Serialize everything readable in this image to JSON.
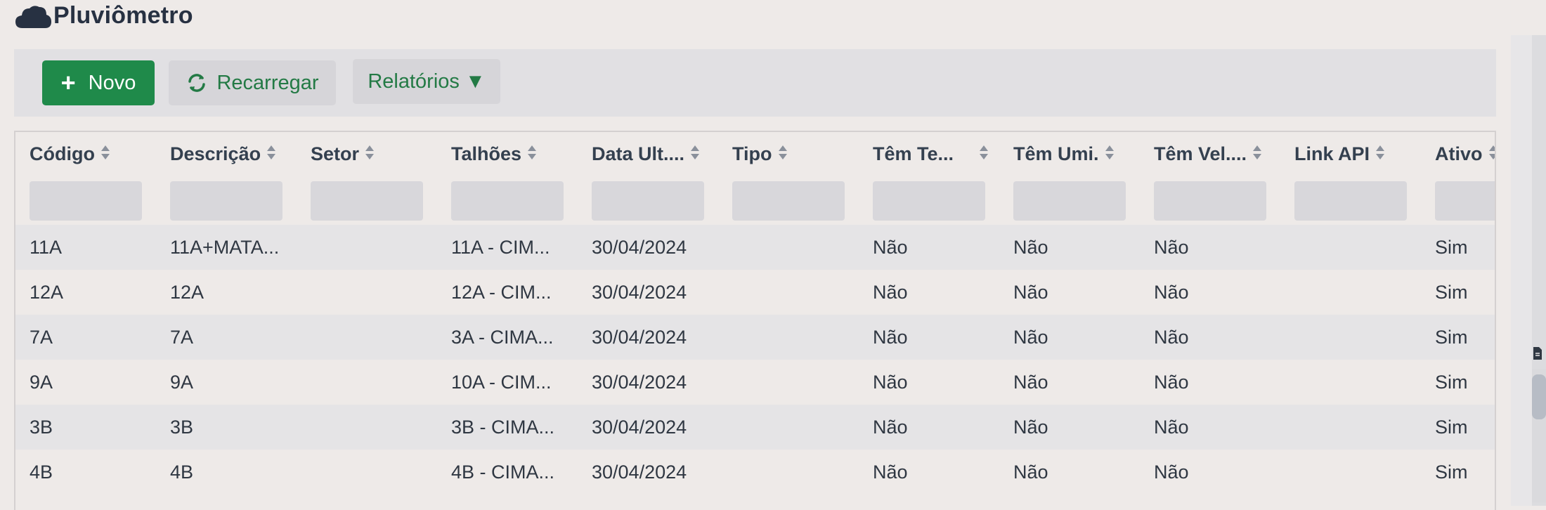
{
  "page": {
    "title": "Pluviômetro",
    "title_icon": "cloud-icon"
  },
  "toolbar": {
    "new_label": "Novo",
    "reload_label": "Recarregar",
    "reports_label": "Relatórios ▼"
  },
  "colors": {
    "primary_green": "#1f8a4a",
    "text_green": "#237a45",
    "title": "#273142",
    "row_alt": "#e5e4e6",
    "background": "#eeeae8"
  },
  "table": {
    "columns": [
      "Código",
      "Descrição",
      "Setor",
      "Talhões",
      "Data Ult....",
      "Tipo",
      "Têm Te...",
      "Têm Umi.",
      "Têm Vel....",
      "Link API",
      "Ativo"
    ],
    "rows": [
      [
        "11A",
        "11A+MATA...",
        "",
        "11A - CIM...",
        "30/04/2024",
        "",
        "Não",
        "Não",
        "Não",
        "",
        "Sim"
      ],
      [
        "12A",
        "12A",
        "",
        "12A - CIM...",
        "30/04/2024",
        "",
        "Não",
        "Não",
        "Não",
        "",
        "Sim"
      ],
      [
        "7A",
        "7A",
        "",
        "3A - CIMA...",
        "30/04/2024",
        "",
        "Não",
        "Não",
        "Não",
        "",
        "Sim"
      ],
      [
        "9A",
        "9A",
        "",
        "10A - CIM...",
        "30/04/2024",
        "",
        "Não",
        "Não",
        "Não",
        "",
        "Sim"
      ],
      [
        "3B",
        "3B",
        "",
        "3B - CIMA...",
        "30/04/2024",
        "",
        "Não",
        "Não",
        "Não",
        "",
        "Sim"
      ],
      [
        "4B",
        "4B",
        "",
        "4B - CIMA...",
        "30/04/2024",
        "",
        "Não",
        "Não",
        "Não",
        "",
        "Sim"
      ]
    ]
  }
}
